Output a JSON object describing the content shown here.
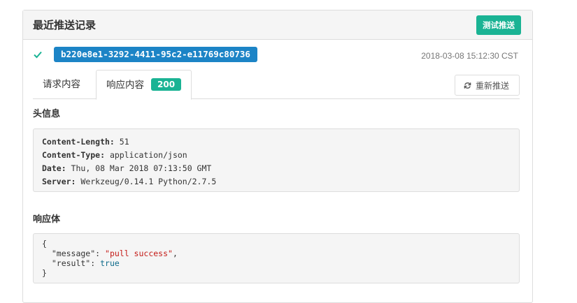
{
  "panel": {
    "title": "最近推送记录",
    "test_push_label": "测试推送"
  },
  "record": {
    "status_icon": "check-icon",
    "delivery_id": "b220e8e1-3292-4411-95c2-e11769c80736",
    "timestamp": "2018-03-08 15:12:30 CST"
  },
  "tabs": {
    "request_label": "请求内容",
    "response_label": "响应内容",
    "response_status": "200",
    "resend_label": "重新推送",
    "resend_icon": "refresh-icon"
  },
  "headers": {
    "title": "头信息",
    "items": [
      {
        "key": "Content-Length:",
        "value": " 51"
      },
      {
        "key": "Content-Type:",
        "value": " application/json"
      },
      {
        "key": "Date:",
        "value": " Thu, 08 Mar 2018 07:13:50 GMT"
      },
      {
        "key": "Server:",
        "value": " Werkzeug/0.14.1 Python/2.7.5"
      }
    ]
  },
  "body": {
    "title": "响应体",
    "open_brace": "{",
    "line1_key": "  \"message\": ",
    "line1_value": "\"pull success\"",
    "line1_end": ",",
    "line2_key": "  \"result\": ",
    "line2_value": "true",
    "close_brace": "}"
  },
  "colors": {
    "success": "#1ab394",
    "primary": "#1c84c6",
    "check": "#1ab394"
  }
}
